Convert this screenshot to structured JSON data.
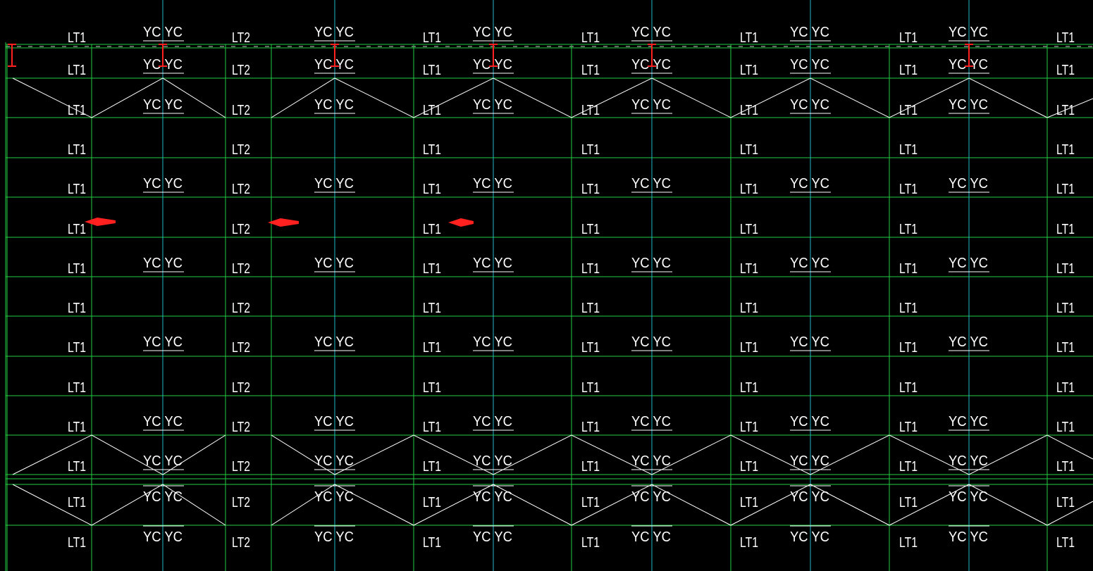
{
  "drawing": {
    "background": "#000000",
    "colors": {
      "grid_line": "#22cc44",
      "axis_line": "#22b7c9",
      "truss_line": "#ffffff",
      "text": "#ffffff",
      "marker": "#ff2020"
    },
    "labels": {
      "lt1": "LT1",
      "lt2": "LT2",
      "yc": "YC",
      "yc_pair": "YC YC"
    },
    "columns": [
      {
        "id": "c1",
        "lt_label": "LT1",
        "yc_label": "YC YC"
      },
      {
        "id": "c2",
        "lt_label": "LT2",
        "yc_label": "YC YC"
      },
      {
        "id": "c3",
        "lt_label": "LT1",
        "yc_label": "YC YC"
      },
      {
        "id": "c4",
        "lt_label": "LT1",
        "yc_label": "YC YC"
      },
      {
        "id": "c5",
        "lt_label": "LT1",
        "yc_label": "YC YC"
      },
      {
        "id": "c6",
        "lt_label": "LT1",
        "yc_label": "YC YC"
      },
      {
        "id": "c7",
        "lt_label": "LT1",
        "yc_label": "YC YC"
      }
    ],
    "rows_with_yc": [
      0,
      1,
      2,
      4,
      6,
      8,
      10,
      11,
      12,
      13
    ],
    "row_count": 14,
    "markers": {
      "i_beam_marks": 6,
      "arrows": 3
    }
  }
}
